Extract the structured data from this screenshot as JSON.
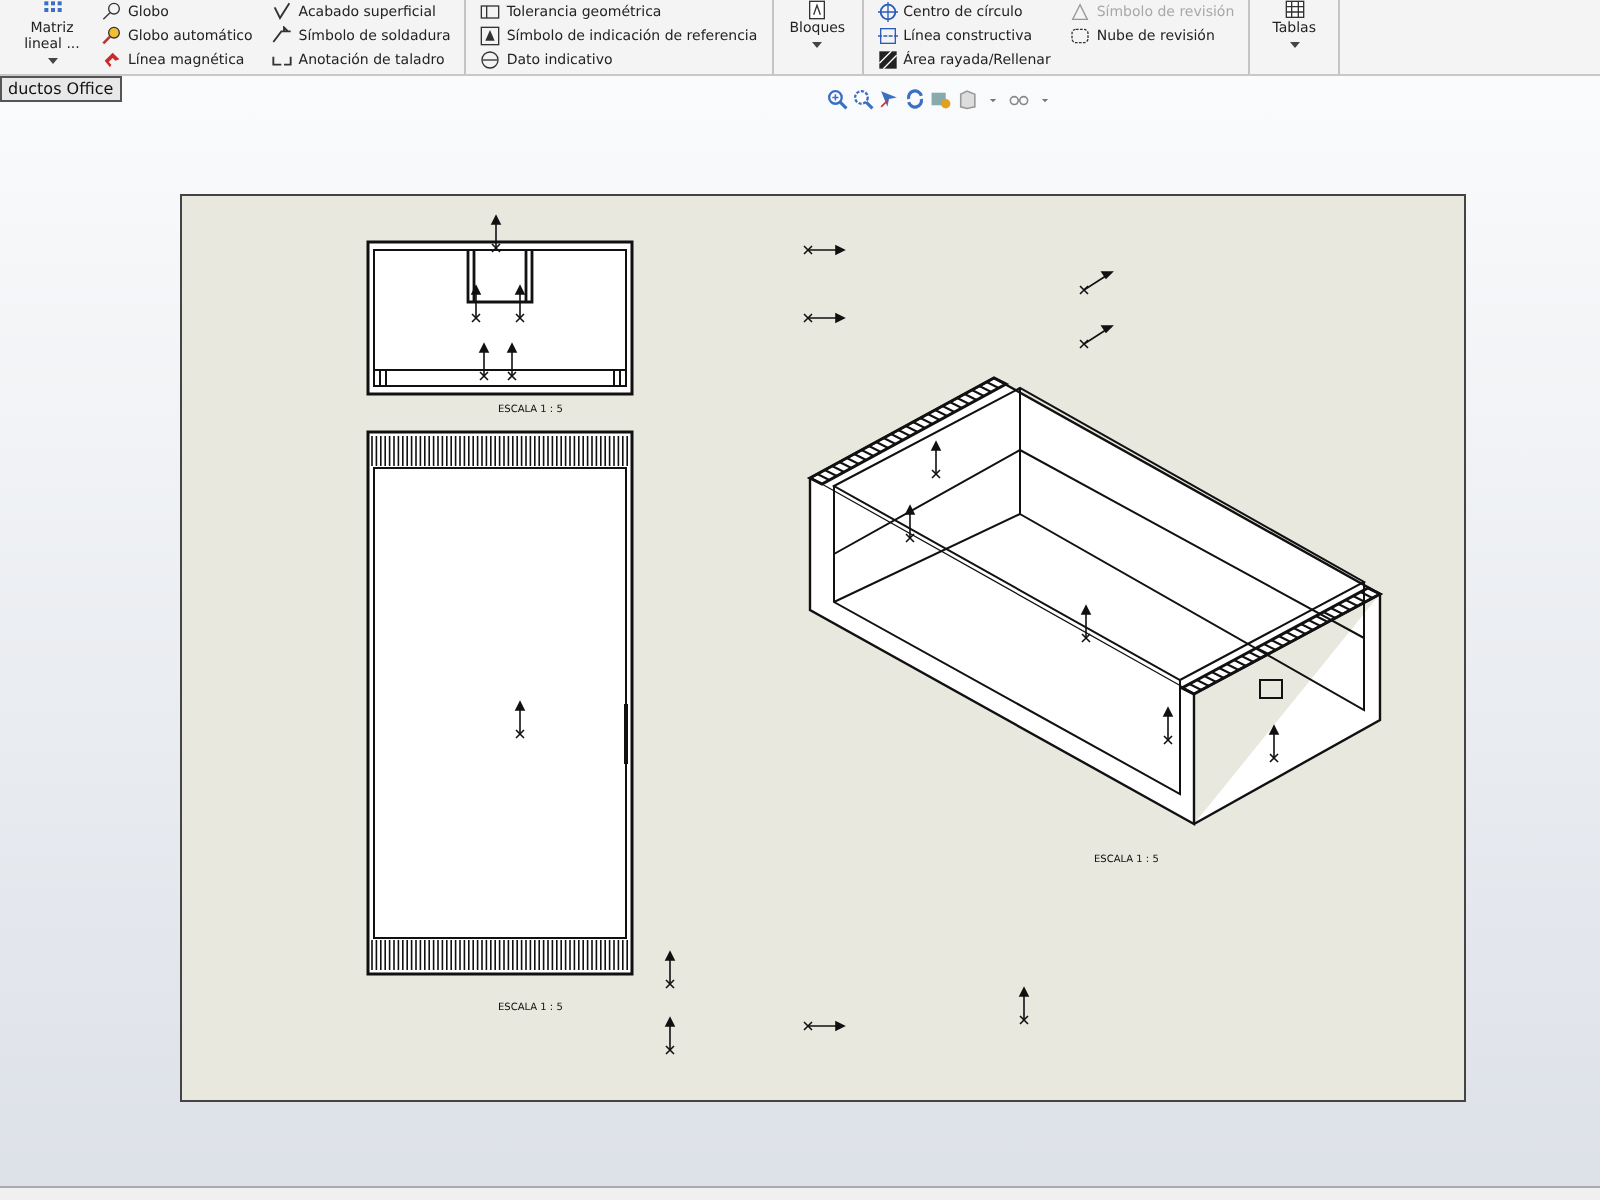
{
  "ribbon": {
    "sections": [
      {
        "groups": [
          {
            "kind": "big",
            "label": "Matriz lineal ..."
          },
          {
            "kind": "column",
            "items": [
              {
                "label": "Globo",
                "disabled": false
              },
              {
                "label": "Globo automático",
                "disabled": false
              },
              {
                "label": "Línea magnética",
                "disabled": false
              }
            ]
          },
          {
            "kind": "column",
            "items": [
              {
                "label": "Acabado superficial",
                "disabled": false
              },
              {
                "label": "Símbolo de soldadura",
                "disabled": false
              },
              {
                "label": "Anotación de taladro",
                "disabled": false
              }
            ]
          }
        ]
      },
      {
        "groups": [
          {
            "kind": "column",
            "items": [
              {
                "label": "Tolerancia geométrica",
                "disabled": false
              },
              {
                "label": "Símbolo de indicación de referencia",
                "disabled": false
              },
              {
                "label": "Dato indicativo",
                "disabled": false
              }
            ]
          }
        ]
      },
      {
        "groups": [
          {
            "kind": "big",
            "label": "Bloques"
          }
        ]
      },
      {
        "groups": [
          {
            "kind": "column",
            "items": [
              {
                "label": "Centro de círculo",
                "disabled": false
              },
              {
                "label": "Línea constructiva",
                "disabled": false
              },
              {
                "label": "Área rayada/Rellenar",
                "disabled": false
              }
            ]
          },
          {
            "kind": "column",
            "items": [
              {
                "label": "Símbolo de revisión",
                "disabled": true
              },
              {
                "label": "Nube de revisión",
                "disabled": false
              }
            ]
          }
        ]
      },
      {
        "groups": [
          {
            "kind": "big",
            "label": "Tablas"
          }
        ]
      }
    ]
  },
  "tooltip": "ductos Office",
  "sheet": {
    "scale_labels": [
      "ESCALA 1 : 5",
      "ESCALA 1 : 5",
      "ESCALA 1 : 5"
    ]
  }
}
